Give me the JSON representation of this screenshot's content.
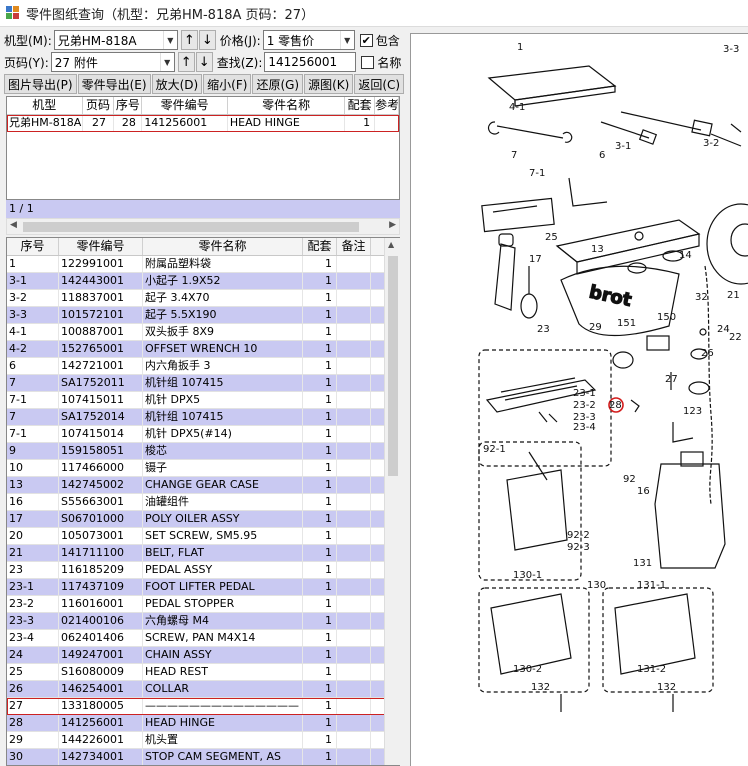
{
  "window": {
    "title": "零件图纸查询（机型：兄弟HM-818A 页码：27）"
  },
  "filters": {
    "model_label": "机型(M):",
    "model_value": "兄弟HM-818A",
    "page_label": "页码(Y):",
    "page_value": "27 附件",
    "price_label": "价格(J):",
    "price_value": "1   零售价",
    "search_label": "查找(Z):",
    "search_value": "141256001",
    "include_label": "包含",
    "include_checked": true,
    "name_label": "名称",
    "name_checked": false,
    "up_arrow": "↑",
    "down_arrow": "↓"
  },
  "toolbar": {
    "buttons": [
      "图片导出(P)",
      "零件导出(E)",
      "放大(D)",
      "缩小(F)",
      "还原(G)",
      "源图(K)",
      "返回(C)"
    ]
  },
  "search_results": {
    "columns": [
      "机型",
      "页码",
      "序号",
      "零件编号",
      "零件名称",
      "配套",
      "参考"
    ],
    "rows": [
      [
        "兄弟HM-818A",
        "27",
        "28",
        "141256001",
        "HEAD HINGE",
        "1",
        ""
      ]
    ],
    "status": "1 / 1"
  },
  "parts_list": {
    "columns": [
      "序号",
      "零件编号",
      "零件名称",
      "配套",
      "备注"
    ],
    "selected_index": 26,
    "rows": [
      [
        "1",
        "122991001",
        "附属品塑料袋",
        "1",
        ""
      ],
      [
        "3-1",
        "142443001",
        "小起子 1.9X52",
        "1",
        ""
      ],
      [
        "3-2",
        "118837001",
        "起子 3.4X70",
        "1",
        ""
      ],
      [
        "3-3",
        "101572101",
        "起子 5.5X190",
        "1",
        ""
      ],
      [
        "4-1",
        "100887001",
        "双头扳手 8X9",
        "1",
        ""
      ],
      [
        "4-2",
        "152765001",
        "OFFSET WRENCH 10",
        "1",
        ""
      ],
      [
        "6",
        "142721001",
        "内六角扳手 3",
        "1",
        ""
      ],
      [
        "7",
        "SA1752011",
        "机针组 107415",
        "1",
        ""
      ],
      [
        "7-1",
        "107415011",
        "机针 DPX5",
        "1",
        ""
      ],
      [
        "7",
        "SA1752014",
        "机针组 107415",
        "1",
        ""
      ],
      [
        "7-1",
        "107415014",
        "机针 DPX5(#14)",
        "1",
        ""
      ],
      [
        "9",
        "159158051",
        "梭芯",
        "1",
        ""
      ],
      [
        "10",
        "117466000",
        "镊子",
        "1",
        ""
      ],
      [
        "13",
        "142745002",
        "CHANGE GEAR CASE",
        "1",
        ""
      ],
      [
        "16",
        "S55663001",
        "油罐组件",
        "1",
        ""
      ],
      [
        "17",
        "S06701000",
        "POLY OILER ASSY",
        "1",
        ""
      ],
      [
        "20",
        "105073001",
        "SET SCREW, SM5.95",
        "1",
        ""
      ],
      [
        "21",
        "141711100",
        "BELT, FLAT",
        "1",
        ""
      ],
      [
        "23",
        "116185209",
        "PEDAL ASSY",
        "1",
        ""
      ],
      [
        "23-1",
        "117437109",
        "FOOT LIFTER PEDAL",
        "1",
        ""
      ],
      [
        "23-2",
        "116016001",
        "PEDAL STOPPER",
        "1",
        ""
      ],
      [
        "23-3",
        "021400106",
        "六角螺母 M4",
        "1",
        ""
      ],
      [
        "23-4",
        "062401406",
        "SCREW, PAN M4X14",
        "1",
        ""
      ],
      [
        "24",
        "149247001",
        "CHAIN ASSY",
        "1",
        ""
      ],
      [
        "25",
        "S16080009",
        "HEAD REST",
        "1",
        ""
      ],
      [
        "26",
        "146254001",
        "COLLAR",
        "1",
        ""
      ],
      [
        "27",
        "133180005",
        "——————————————",
        "1",
        ""
      ],
      [
        "28",
        "141256001",
        "HEAD HINGE",
        "1",
        ""
      ],
      [
        "29",
        "144226001",
        "机头置",
        "1",
        ""
      ],
      [
        "30",
        "142734001",
        "STOP CAM SEGMENT, AS",
        "1",
        ""
      ]
    ]
  },
  "drawing": {
    "callouts": [
      "1",
      "3-3",
      "4-1",
      "3-1",
      "3-2",
      "7",
      "7-1",
      "6",
      "13",
      "14",
      "25",
      "17",
      "29",
      "32",
      "24",
      "21",
      "22",
      "23",
      "151",
      "150",
      "26",
      "27",
      "23-1",
      "23-2",
      "23-3",
      "23-4",
      "28",
      "123",
      "92-1",
      "92",
      "16",
      "92-2",
      "92-3",
      "130-1",
      "130",
      "131",
      "131-1",
      "130-2",
      "131-2",
      "132",
      "132"
    ],
    "highlight_callout": "28"
  }
}
